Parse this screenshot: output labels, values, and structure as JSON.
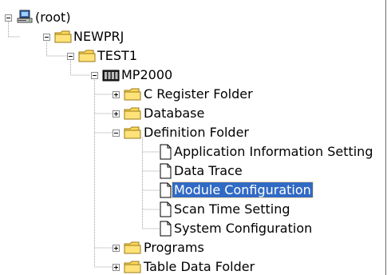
{
  "tree": {
    "root": {
      "label": "(root)",
      "expanded": true,
      "icon": "workstation-icon"
    },
    "newprj": {
      "label": "NEWPRJ",
      "expanded": true,
      "icon": "folder-icon"
    },
    "test1": {
      "label": "TEST1",
      "expanded": true,
      "icon": "folder-icon"
    },
    "mp2000": {
      "label": "MP2000",
      "expanded": true,
      "icon": "controller-icon"
    },
    "c_register": {
      "label": "C Register Folder",
      "expanded": false,
      "icon": "folder-icon"
    },
    "database": {
      "label": "Database",
      "expanded": false,
      "icon": "folder-icon"
    },
    "definition": {
      "label": "Definition Folder",
      "expanded": true,
      "icon": "folder-icon"
    },
    "app_info": {
      "label": "Application Information Setting",
      "icon": "document-icon"
    },
    "data_trace": {
      "label": "Data Trace",
      "icon": "document-icon"
    },
    "module_config": {
      "label": "Module Configuration",
      "icon": "document-icon",
      "selected": true
    },
    "scan_time": {
      "label": "Scan Time Setting",
      "icon": "document-icon"
    },
    "system_config": {
      "label": "System Configuration",
      "icon": "document-icon"
    },
    "programs": {
      "label": "Programs",
      "expanded": false,
      "icon": "folder-icon"
    },
    "table_data": {
      "label": "Table Data Folder",
      "expanded": false,
      "icon": "folder-icon"
    }
  },
  "colors": {
    "selection": "#316ac5",
    "folder": "#ffd95a",
    "folder_edge": "#9a7a14",
    "tree_line": "#a0a0a0"
  }
}
